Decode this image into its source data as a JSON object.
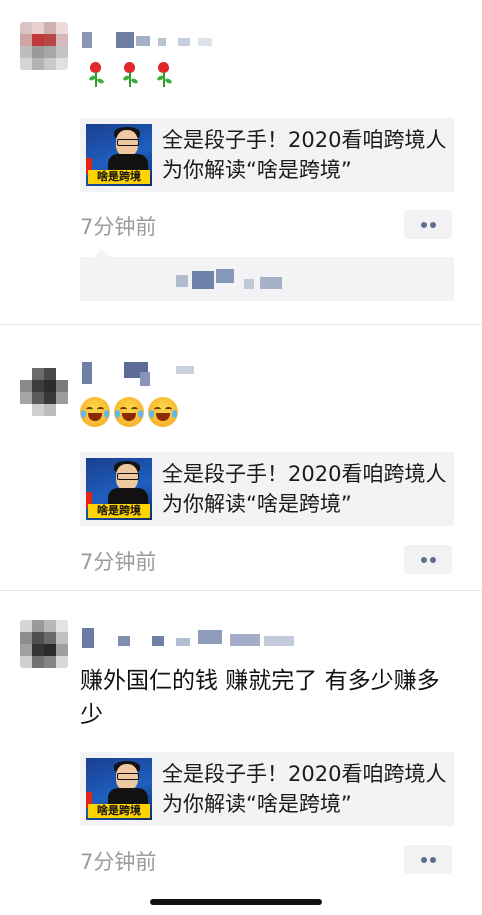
{
  "share_card": {
    "title": "全是段子手！2020看咱跨境人为你解读“啥是跨境”",
    "thumb_caption": "啥是跨境"
  },
  "posts": [
    {
      "time": "7分钟前",
      "emoji": [
        "rose",
        "rose",
        "rose"
      ]
    },
    {
      "time": "7分钟前",
      "emoji": [
        "laughing-crying-face",
        "laughing-crying-face",
        "laughing-crying-face"
      ]
    },
    {
      "time": "7分钟前",
      "text": "赚外国仁的钱 赚就完了 有多少赚多少"
    }
  ],
  "more_icon": "ellipsis-icon",
  "colors": {
    "time_gray": "#9b9b9b",
    "card_bg": "#f3f3f5",
    "more_dots": "#5d6e8f"
  }
}
